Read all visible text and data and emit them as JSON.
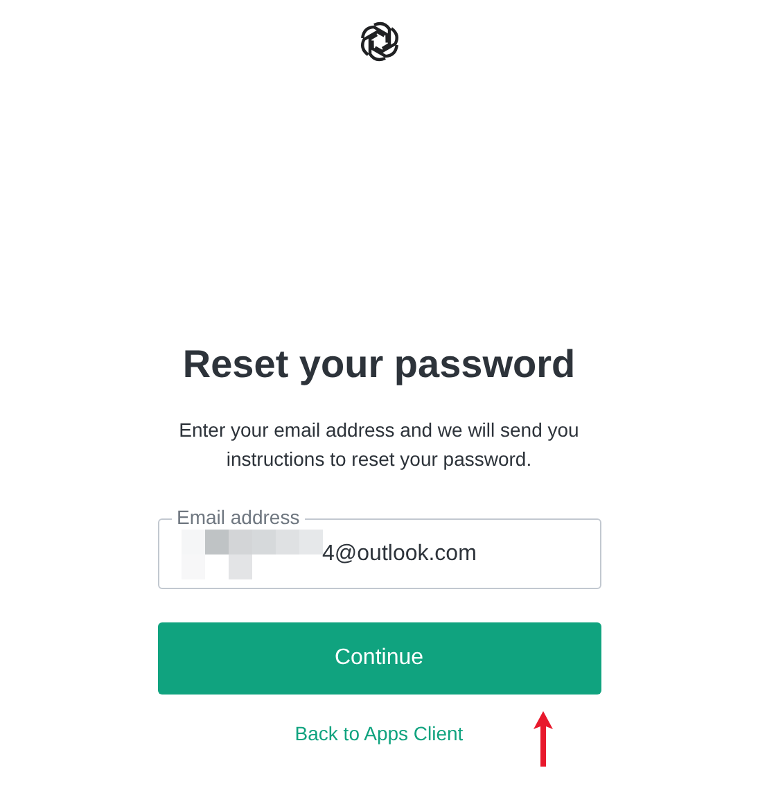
{
  "heading": "Reset your password",
  "description": "Enter your email address and we will send you instructions to reset your password.",
  "email_field": {
    "label": "Email address",
    "value": "4@outlook.com"
  },
  "continue_button": "Continue",
  "back_link": "Back to Apps Client"
}
